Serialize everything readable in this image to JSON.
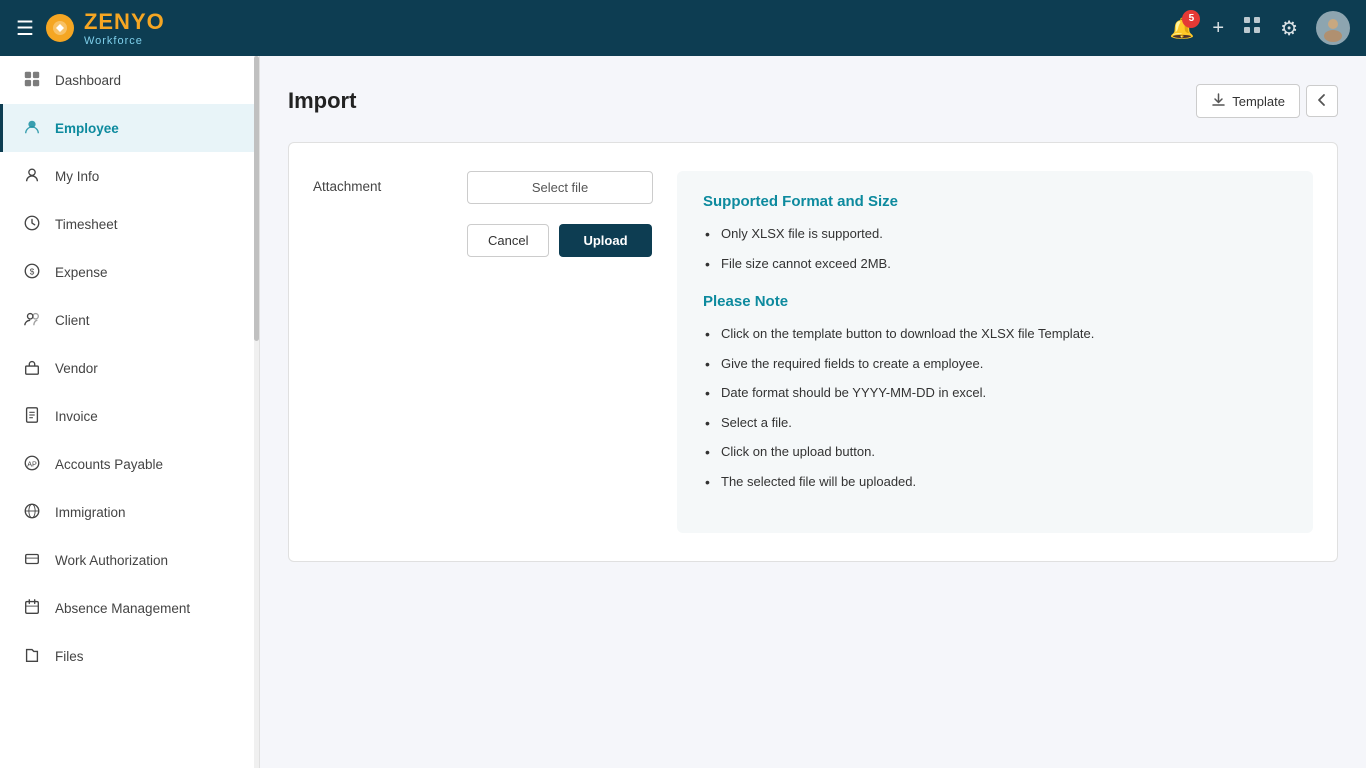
{
  "app": {
    "name": "ZENYO",
    "subtitle": "Workforce",
    "notification_count": "5"
  },
  "topnav": {
    "hamburger_label": "☰",
    "bell_label": "🔔",
    "plus_label": "+",
    "grid_label": "⊞",
    "gear_label": "⚙"
  },
  "sidebar": {
    "items": [
      {
        "id": "dashboard",
        "label": "Dashboard",
        "icon": "dashboard"
      },
      {
        "id": "employee",
        "label": "Employee",
        "icon": "employee",
        "active": true
      },
      {
        "id": "myinfo",
        "label": "My Info",
        "icon": "person"
      },
      {
        "id": "timesheet",
        "label": "Timesheet",
        "icon": "clock"
      },
      {
        "id": "expense",
        "label": "Expense",
        "icon": "expense"
      },
      {
        "id": "client",
        "label": "Client",
        "icon": "client"
      },
      {
        "id": "vendor",
        "label": "Vendor",
        "icon": "vendor"
      },
      {
        "id": "invoice",
        "label": "Invoice",
        "icon": "invoice"
      },
      {
        "id": "accounts-payable",
        "label": "Accounts Payable",
        "icon": "accounts"
      },
      {
        "id": "immigration",
        "label": "Immigration",
        "icon": "immigration"
      },
      {
        "id": "work-authorization",
        "label": "Work Authorization",
        "icon": "work-auth"
      },
      {
        "id": "absence-management",
        "label": "Absence Management",
        "icon": "absence"
      },
      {
        "id": "files",
        "label": "Files",
        "icon": "files"
      }
    ]
  },
  "page": {
    "title": "Import",
    "template_btn_label": "Template",
    "back_btn_label": "←"
  },
  "form": {
    "attachment_label": "Attachment",
    "select_file_label": "Select file",
    "cancel_btn": "Cancel",
    "upload_btn": "Upload"
  },
  "info_panel": {
    "format_title": "Supported Format and Size",
    "format_items": [
      "Only XLSX file is supported.",
      "File size cannot exceed 2MB."
    ],
    "note_title": "Please Note",
    "note_items": [
      "Click on the template button to download the XLSX file Template.",
      "Give the required fields to create a employee.",
      "Date format should be YYYY-MM-DD in excel.",
      "Select a file.",
      "Click on the upload button.",
      "The selected file will be uploaded."
    ]
  }
}
